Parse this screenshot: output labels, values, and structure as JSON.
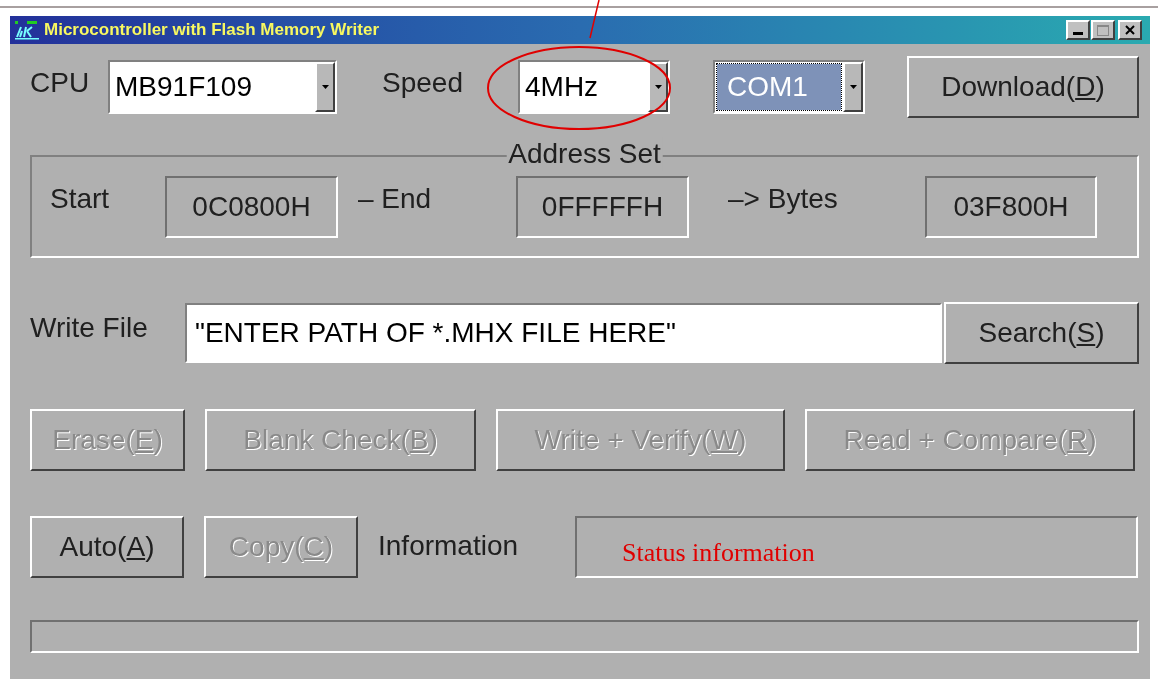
{
  "window": {
    "title": "Microcontroller with Flash Memory Writer"
  },
  "cpu": {
    "label": "CPU",
    "value": "MB91F109"
  },
  "speed": {
    "label": "Speed",
    "value": "4MHz"
  },
  "port": {
    "value": "COM1",
    "selected": true
  },
  "download_button": {
    "before": "Download(",
    "key": "D",
    "after": ")",
    "disabled": false
  },
  "address_set": {
    "title": "Address Set",
    "start_label": "Start",
    "start": "0C0800H",
    "end_label": "– End",
    "end": "0FFFFFH",
    "bytes_label": "–> Bytes",
    "bytes": "03F800H"
  },
  "write_file": {
    "label": "Write File",
    "value": "\"ENTER PATH OF *.MHX FILE HERE\""
  },
  "search_button": {
    "before": "Search(",
    "key": "S",
    "after": ")",
    "disabled": false
  },
  "action_buttons": [
    {
      "before": "Erase(",
      "key": "E",
      "after": ")",
      "disabled": true
    },
    {
      "before": "Blank Check(",
      "key": "B",
      "after": ")",
      "disabled": true
    },
    {
      "before": "Write + Verify(",
      "key": "W",
      "after": ")",
      "disabled": true
    },
    {
      "before": "Read + Compare(",
      "key": "R",
      "after": ")",
      "disabled": true
    }
  ],
  "auto_button": {
    "before": "Auto(",
    "key": "A",
    "after": ")",
    "disabled": false
  },
  "copy_button": {
    "before": "Copy(",
    "key": "C",
    "after": ")",
    "disabled": true
  },
  "information": {
    "label": "Information",
    "value": "Status information"
  },
  "progress": {
    "level": 0
  }
}
